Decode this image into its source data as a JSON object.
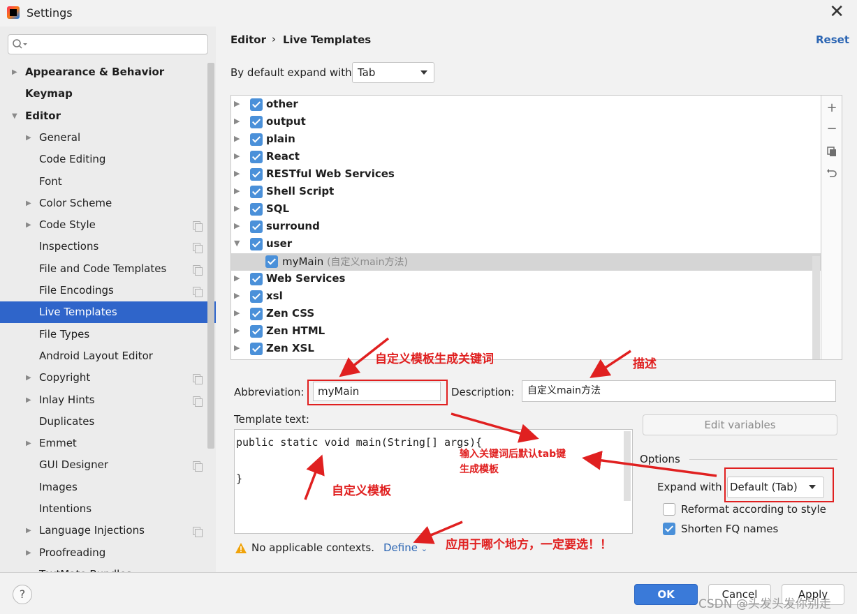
{
  "window": {
    "title": "Settings",
    "close_glyph": "✕"
  },
  "sidebar": {
    "search_placeholder": "",
    "items": [
      {
        "label": "Appearance & Behavior",
        "bold": true,
        "arrow": "▶",
        "level": 0
      },
      {
        "label": "Keymap",
        "bold": true,
        "level": 0
      },
      {
        "label": "Editor",
        "bold": true,
        "arrow": "▼",
        "level": 0
      },
      {
        "label": "General",
        "arrow": "▶",
        "level": 1
      },
      {
        "label": "Code Editing",
        "level": 1
      },
      {
        "label": "Font",
        "level": 1
      },
      {
        "label": "Color Scheme",
        "arrow": "▶",
        "level": 1
      },
      {
        "label": "Code Style",
        "arrow": "▶",
        "level": 1,
        "page_icon": true
      },
      {
        "label": "Inspections",
        "level": 1,
        "page_icon": true
      },
      {
        "label": "File and Code Templates",
        "level": 1,
        "page_icon": true
      },
      {
        "label": "File Encodings",
        "level": 1,
        "page_icon": true
      },
      {
        "label": "Live Templates",
        "level": 1,
        "selected": true
      },
      {
        "label": "File Types",
        "level": 1
      },
      {
        "label": "Android Layout Editor",
        "level": 1
      },
      {
        "label": "Copyright",
        "arrow": "▶",
        "level": 1,
        "page_icon": true
      },
      {
        "label": "Inlay Hints",
        "arrow": "▶",
        "level": 1,
        "page_icon": true
      },
      {
        "label": "Duplicates",
        "level": 1
      },
      {
        "label": "Emmet",
        "arrow": "▶",
        "level": 1
      },
      {
        "label": "GUI Designer",
        "level": 1,
        "page_icon": true
      },
      {
        "label": "Images",
        "level": 1
      },
      {
        "label": "Intentions",
        "level": 1
      },
      {
        "label": "Language Injections",
        "arrow": "▶",
        "level": 1,
        "page_icon": true
      },
      {
        "label": "Proofreading",
        "arrow": "▶",
        "level": 1
      },
      {
        "label": "TextMate Bundles",
        "level": 1
      }
    ]
  },
  "header": {
    "breadcrumb_root": "Editor",
    "breadcrumb_sep": "›",
    "breadcrumb_page": "Live Templates",
    "reset": "Reset"
  },
  "expand_default": {
    "label": "By default expand with",
    "value": "Tab"
  },
  "templates": [
    {
      "label": "other",
      "expanded": false,
      "checked": true
    },
    {
      "label": "output",
      "expanded": false,
      "checked": true
    },
    {
      "label": "plain",
      "expanded": false,
      "checked": true
    },
    {
      "label": "React",
      "expanded": false,
      "checked": true
    },
    {
      "label": "RESTful Web Services",
      "expanded": false,
      "checked": true
    },
    {
      "label": "Shell Script",
      "expanded": false,
      "checked": true
    },
    {
      "label": "SQL",
      "expanded": false,
      "checked": true
    },
    {
      "label": "surround",
      "expanded": false,
      "checked": true
    },
    {
      "label": "user",
      "expanded": true,
      "checked": true
    },
    {
      "label": "myMain",
      "desc": "(自定义main方法)",
      "child": true,
      "checked": true,
      "selected": true
    },
    {
      "label": "Web Services",
      "expanded": false,
      "checked": true
    },
    {
      "label": "xsl",
      "expanded": false,
      "checked": true
    },
    {
      "label": "Zen CSS",
      "expanded": false,
      "checked": true
    },
    {
      "label": "Zen HTML",
      "expanded": false,
      "checked": true
    },
    {
      "label": "Zen XSL",
      "expanded": false,
      "checked": true
    }
  ],
  "toolbar": [
    "add-icon",
    "remove-icon",
    "copy-icon",
    "undo-icon"
  ],
  "editor": {
    "abbreviation_label": "Abbreviation:",
    "abbreviation_value": "myMain",
    "description_label": "Description:",
    "description_value": "自定义main方法",
    "template_text_label": "Template text:",
    "template_text": "public static void main(String[] args){\n\n}",
    "edit_variables": "Edit variables",
    "options_label": "Options",
    "expand_with_label": "Expand with",
    "expand_with_value": "Default (Tab)",
    "reformat_label": "Reformat according to style",
    "reformat_checked": false,
    "shorten_label": "Shorten FQ names",
    "shorten_checked": true,
    "context_warning": "No applicable contexts.",
    "define_link": "Define"
  },
  "buttons": {
    "help": "?",
    "ok": "OK",
    "cancel": "Cancel",
    "apply": "Apply"
  },
  "watermark": "CSDN @头发头发你别走",
  "annotations": {
    "abbr_note": "自定义模板生成关键词",
    "desc_note": "描述",
    "expand_note_line1": "输入关键词后默认tab键",
    "expand_note_line2": "生成模板",
    "template_note": "自定义模板",
    "context_note": "应用于哪个地方，一定要选！！"
  },
  "colors": {
    "accent": "#2f65ca",
    "checkbox": "#4a90d9",
    "annotation": "#e02020",
    "link": "#2b65b3"
  }
}
